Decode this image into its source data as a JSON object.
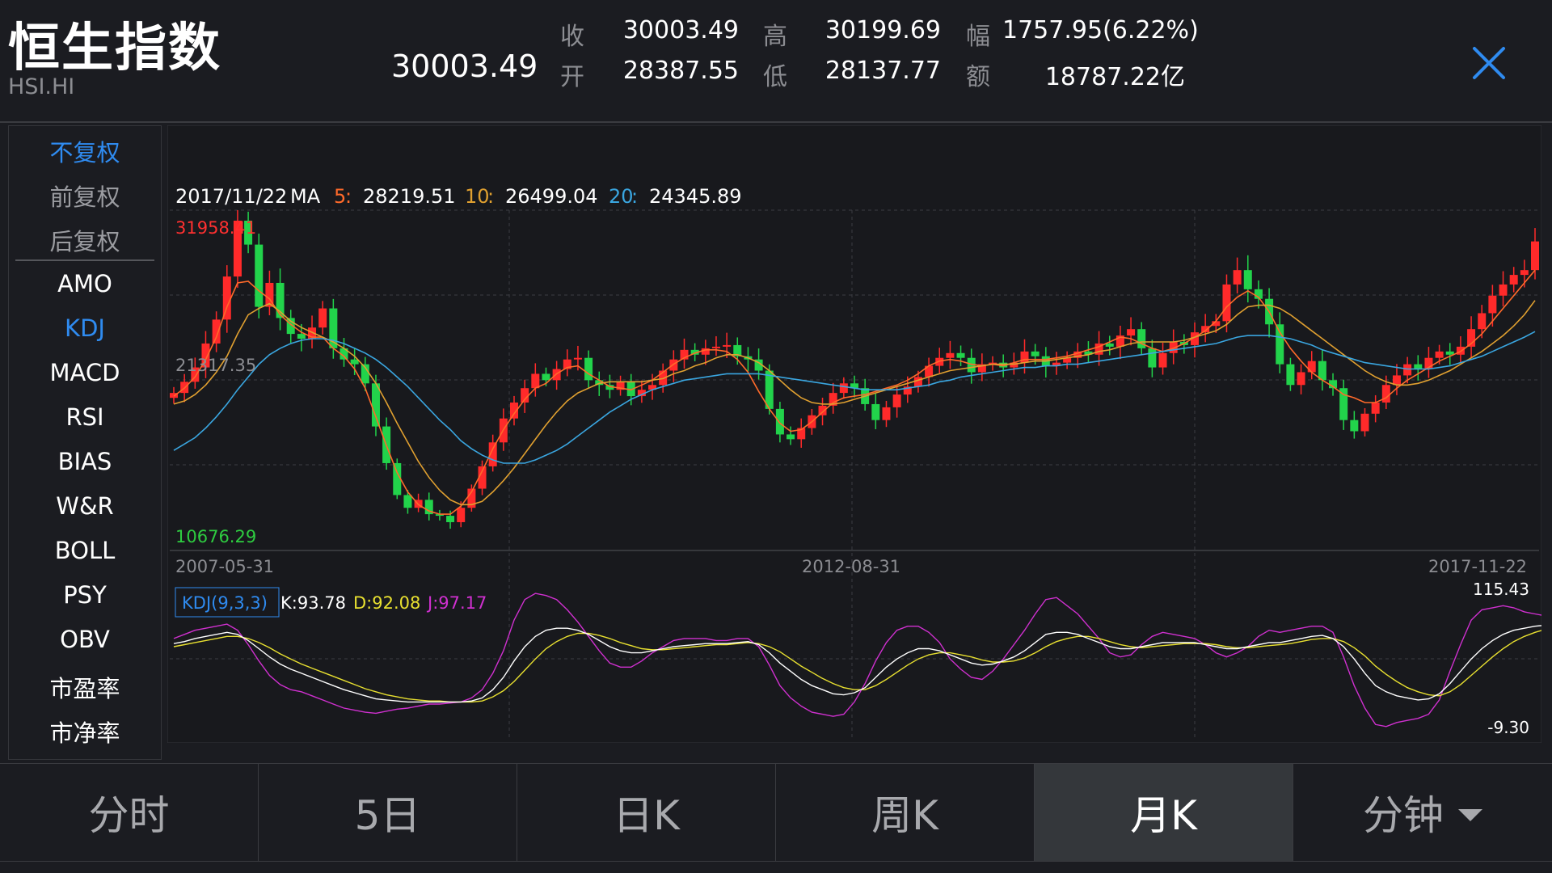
{
  "header": {
    "title": "恒生指数",
    "code": "HSI.HI",
    "price": "30003.49",
    "quote": {
      "close_label": "收",
      "close": "30003.49",
      "open_label": "开",
      "open": "28387.55",
      "high_label": "高",
      "high": "30199.69",
      "low_label": "低",
      "low": "28137.77",
      "change_label": "幅",
      "change": "1757.95(6.22%)",
      "amount_label": "额",
      "amount": "18787.22亿"
    },
    "close_icon": "close-icon"
  },
  "side_menu": {
    "adjust": [
      "不复权",
      "前复权",
      "后复权"
    ],
    "active_adjust": "不复权",
    "indicators": [
      "AMO",
      "KDJ",
      "MACD",
      "RSI",
      "BIAS",
      "W&R",
      "BOLL",
      "PSY",
      "OBV",
      "市盈率",
      "市净率"
    ],
    "active_indicator": "KDJ"
  },
  "main_chart": {
    "date": "2017/11/22",
    "ma_label": "MA",
    "ma": [
      {
        "period": "5",
        "sep": " : ",
        "value": "28219.51",
        "color": "#ff6a2a"
      },
      {
        "period": "10",
        "sep": " : ",
        "value": "26499.04",
        "color": "#e0a030"
      },
      {
        "period": "20",
        "sep": " : ",
        "value": "24345.89",
        "color": "#3aa6e0"
      }
    ],
    "max_label": "31958.41",
    "mid_label": "21317.35",
    "min_label": "10676.29",
    "x_labels": [
      "2007-05-31",
      "2012-08-31",
      "2017-11-22"
    ]
  },
  "kdj": {
    "label": "KDJ(9,3,3)",
    "k": "K:93.78",
    "d": "D:92.08",
    "j": "J:97.17",
    "max_label": "115.43",
    "min_label": "-9.30",
    "colors": {
      "k": "#ffffff",
      "d": "#e8e030",
      "j": "#d030d0"
    }
  },
  "chart_data": {
    "type": "candlestick",
    "x_range": [
      "2007-05-31",
      "2017-11-22"
    ],
    "y_range": [
      10676.29,
      31958.41
    ],
    "close": [
      20500,
      21200,
      22100,
      23600,
      25100,
      27800,
      31300,
      29800,
      25900,
      27400,
      25200,
      24200,
      23900,
      24600,
      25800,
      23300,
      22600,
      22300,
      21100,
      18400,
      16100,
      14100,
      13300,
      13800,
      12900,
      12800,
      12400,
      13300,
      14500,
      15900,
      17400,
      18900,
      19900,
      20800,
      21700,
      21300,
      22000,
      22600,
      22700,
      21300,
      21000,
      20700,
      21200,
      20300,
      20700,
      21000,
      21900,
      22600,
      23200,
      22900,
      23300,
      23400,
      23500,
      22800,
      22600,
      21900,
      19500,
      17900,
      17600,
      18300,
      19100,
      19700,
      20500,
      21100,
      20800,
      19800,
      18800,
      19600,
      20400,
      20900,
      21500,
      22200,
      22700,
      23000,
      22700,
      21800,
      22300,
      22400,
      22100,
      22400,
      23100,
      22800,
      22200,
      22400,
      22700,
      23100,
      22900,
      23600,
      23400,
      24100,
      24500,
      23300,
      22100,
      23000,
      23700,
      23500,
      24300,
      24700,
      25000,
      27300,
      28200,
      27000,
      26400,
      24800,
      22300,
      21000,
      21800,
      22500,
      21300,
      20800,
      18800,
      18100,
      19200,
      19900,
      21000,
      21600,
      22300,
      22000,
      22700,
      23100,
      22900,
      23400,
      24500,
      25500,
      26600,
      27300,
      27900,
      28200,
      30000
    ],
    "ma5": [
      20300,
      20800,
      21500,
      22600,
      24000,
      25900,
      27400,
      27500,
      26900,
      26400,
      25400,
      24800,
      24300,
      24000,
      24000,
      23300,
      22800,
      22000,
      20800,
      19000,
      17200,
      15500,
      14300,
      13500,
      13100,
      12900,
      12900,
      13400,
      14300,
      15600,
      17000,
      18200,
      19200,
      20100,
      20800,
      21100,
      21700,
      22100,
      22200,
      21700,
      21300,
      20900,
      20800,
      20700,
      21000,
      21300,
      21800,
      22300,
      22700,
      23000,
      23200,
      23200,
      23100,
      22600,
      21800,
      20600,
      19500,
      18600,
      18100,
      18200,
      18700,
      19300,
      19900,
      20200,
      20300,
      20400,
      20600,
      20800,
      21000,
      21300,
      21700,
      22200,
      22500,
      22600,
      22500,
      22300,
      22200,
      22300,
      22200,
      22400,
      22600,
      22600,
      22600,
      22700,
      22800,
      23000,
      23200,
      23400,
      23700,
      24000,
      23900,
      23600,
      23300,
      23100,
      23300,
      23600,
      24000,
      24400,
      25000,
      25900,
      26500,
      26900,
      26500,
      25600,
      24300,
      23300,
      22500,
      21800,
      21300,
      20900,
      20400,
      20200,
      19900,
      19900,
      20200,
      20800,
      21300,
      21700,
      22100,
      22500,
      22800,
      23100,
      23600,
      24200,
      25000,
      25800,
      26600,
      27400,
      28200
    ],
    "ma10": [
      19800,
      20000,
      20400,
      21000,
      21800,
      22800,
      24200,
      25400,
      25800,
      26100,
      25600,
      25000,
      24600,
      24300,
      24000,
      23700,
      23300,
      22800,
      22100,
      21100,
      19900,
      18600,
      17400,
      16200,
      15200,
      14400,
      13800,
      13500,
      13500,
      13700,
      14300,
      15000,
      15800,
      16700,
      17600,
      18500,
      19300,
      20000,
      20500,
      20800,
      21100,
      21200,
      21200,
      21200,
      21200,
      21300,
      21400,
      21700,
      21900,
      22200,
      22400,
      22700,
      22900,
      22900,
      22700,
      22400,
      21900,
      21300,
      20700,
      20200,
      19900,
      19800,
      19800,
      19900,
      20100,
      20300,
      20500,
      20700,
      20900,
      21100,
      21300,
      21500,
      21700,
      21900,
      22000,
      22100,
      22200,
      22300,
      22300,
      22300,
      22400,
      22500,
      22500,
      22600,
      22700,
      22800,
      22900,
      23100,
      23200,
      23400,
      23600,
      23700,
      23700,
      23700,
      23700,
      23800,
      24000,
      24200,
      24400,
      24800,
      25400,
      25900,
      26000,
      26000,
      25800,
      25400,
      24900,
      24400,
      23900,
      23400,
      22900,
      22400,
      21900,
      21500,
      21200,
      21000,
      21000,
      21100,
      21300,
      21600,
      21900,
      22300,
      22700,
      23100,
      23600,
      24100,
      24700,
      25400,
      26300
    ],
    "ma20": [
      16900,
      17300,
      17700,
      18300,
      19000,
      19800,
      20700,
      21500,
      22300,
      22900,
      23300,
      23600,
      23800,
      23900,
      23900,
      23800,
      23600,
      23300,
      23000,
      22600,
      22100,
      21500,
      20900,
      20200,
      19500,
      18800,
      18200,
      17500,
      17000,
      16600,
      16300,
      16100,
      16100,
      16100,
      16300,
      16600,
      16900,
      17300,
      17800,
      18300,
      18800,
      19300,
      19700,
      20100,
      20400,
      20700,
      20900,
      21100,
      21300,
      21400,
      21500,
      21600,
      21700,
      21700,
      21700,
      21700,
      21600,
      21500,
      21400,
      21300,
      21200,
      21100,
      21000,
      20900,
      20800,
      20700,
      20700,
      20700,
      20700,
      20800,
      20900,
      21000,
      21200,
      21300,
      21500,
      21600,
      21700,
      21800,
      21900,
      22000,
      22100,
      22100,
      22200,
      22200,
      22300,
      22300,
      22400,
      22500,
      22600,
      22700,
      22800,
      22900,
      23000,
      23100,
      23200,
      23300,
      23400,
      23500,
      23600,
      23800,
      24000,
      24100,
      24100,
      24100,
      24000,
      23900,
      23700,
      23500,
      23200,
      23000,
      22800,
      22600,
      22400,
      22300,
      22200,
      22100,
      22000,
      22000,
      22000,
      22100,
      22200,
      22400,
      22600,
      22800,
      23100,
      23400,
      23700,
      24000,
      24350
    ],
    "kdj_k": [
      75,
      77,
      80,
      82,
      84,
      86,
      84,
      78,
      70,
      62,
      55,
      50,
      46,
      42,
      38,
      34,
      30,
      27,
      24,
      21,
      20,
      19,
      18,
      18,
      18,
      18,
      18,
      18,
      19,
      22,
      30,
      42,
      58,
      72,
      82,
      88,
      90,
      90,
      88,
      84,
      78,
      72,
      68,
      66,
      66,
      68,
      70,
      72,
      73,
      74,
      75,
      75,
      75,
      76,
      77,
      74,
      66,
      56,
      48,
      40,
      34,
      30,
      26,
      25,
      27,
      32,
      42,
      52,
      60,
      66,
      70,
      70,
      68,
      64,
      60,
      56,
      54,
      55,
      58,
      62,
      68,
      76,
      84,
      86,
      86,
      84,
      80,
      76,
      72,
      70,
      70,
      72,
      74,
      76,
      76,
      76,
      76,
      74,
      72,
      70,
      70,
      72,
      74,
      76,
      76,
      78,
      80,
      82,
      83,
      80,
      72,
      60,
      46,
      34,
      28,
      24,
      22,
      20,
      21,
      26,
      36,
      48,
      60,
      70,
      78,
      84,
      88,
      90,
      92,
      93,
      94
    ],
    "kdj_d": [
      72,
      74,
      76,
      78,
      80,
      82,
      82,
      80,
      76,
      71,
      65,
      60,
      55,
      51,
      47,
      43,
      39,
      35,
      31,
      28,
      25,
      23,
      21,
      20,
      19,
      19,
      18,
      18,
      18,
      19,
      23,
      29,
      38,
      49,
      60,
      70,
      77,
      82,
      85,
      85,
      83,
      80,
      76,
      73,
      70,
      69,
      69,
      70,
      71,
      72,
      73,
      74,
      74,
      75,
      76,
      75,
      72,
      67,
      60,
      53,
      47,
      41,
      36,
      32,
      30,
      30,
      34,
      40,
      47,
      54,
      60,
      64,
      66,
      66,
      64,
      62,
      59,
      57,
      57,
      58,
      61,
      66,
      72,
      77,
      80,
      82,
      82,
      80,
      77,
      74,
      72,
      71,
      72,
      73,
      74,
      75,
      75,
      75,
      74,
      72,
      71,
      71,
      72,
      73,
      74,
      75,
      77,
      79,
      80,
      80,
      77,
      71,
      63,
      53,
      45,
      38,
      32,
      28,
      25,
      24,
      28,
      35,
      44,
      53,
      62,
      70,
      77,
      82,
      86,
      89,
      91,
      92
    ],
    "kdj_j": [
      80,
      84,
      88,
      90,
      92,
      94,
      88,
      74,
      58,
      44,
      35,
      30,
      28,
      24,
      20,
      16,
      12,
      10,
      8,
      7,
      9,
      11,
      12,
      14,
      16,
      16,
      17,
      18,
      22,
      30,
      46,
      68,
      98,
      118,
      124,
      122,
      118,
      108,
      96,
      82,
      68,
      56,
      52,
      52,
      58,
      66,
      72,
      78,
      80,
      80,
      80,
      78,
      78,
      80,
      80,
      72,
      54,
      34,
      22,
      14,
      8,
      6,
      4,
      6,
      18,
      36,
      58,
      76,
      88,
      92,
      92,
      86,
      76,
      60,
      50,
      42,
      40,
      48,
      60,
      74,
      88,
      104,
      118,
      120,
      112,
      104,
      92,
      80,
      66,
      62,
      64,
      74,
      82,
      86,
      84,
      82,
      80,
      74,
      66,
      62,
      66,
      72,
      82,
      88,
      86,
      88,
      90,
      92,
      92,
      86,
      62,
      34,
      12,
      -4,
      -6,
      -2,
      0,
      2,
      6,
      20,
      48,
      74,
      98,
      108,
      110,
      112,
      110,
      106,
      104,
      102,
      100,
      97
    ]
  }
}
